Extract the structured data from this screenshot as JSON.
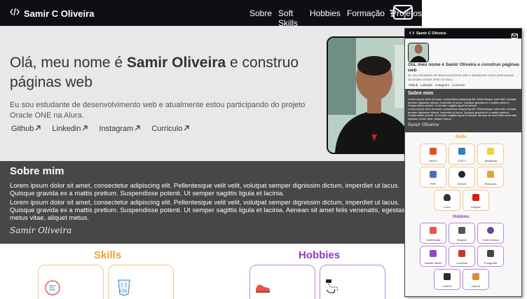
{
  "navbar": {
    "brand": "Samir C Oliveira",
    "links": [
      "Sobre",
      "Soft Skills",
      "Hobbies",
      "Formação",
      "Projetos"
    ]
  },
  "hero": {
    "title_plain": "Olá, meu nome é ",
    "title_bold": "Samir Oliveira",
    "title_end": " e construo páginas web",
    "description": "Eu sou estudante de desenvolvimento web e atualmente estou participando do projeto Oracle ONE na Alura.",
    "links": [
      "Github",
      "Linkedin",
      "Instagram",
      "Curriculo"
    ]
  },
  "about": {
    "heading": "Sobre mim",
    "p1": "Lorem ipsum dolor sit amet, consectetur adipiscing elit. Pellentesque velit velit, volutpat semper dignissim dictum, imperdiet ut lacus. Quisque gravida ex a mattis pretium. Suspendisse potenti. Ut semper sagittis ligula et lacinia.",
    "p2": "Lorem ipsum dolor sit amet, consectetur adipiscing elit. Pellentesque velit velit, volutpat semper dignissim dictum, imperdiet ut lacus. Quisque gravida ex a mattis pretium. Suspendisse potenti. Ut semper sagittis ligula et lacinia. Aenean sit amet felis venenatis, egestas metus vitae, aliquet metus.",
    "signature": "Samir Oliveira"
  },
  "sections": {
    "skills": "Skills",
    "hobbies": "Hobbies"
  },
  "mobile": {
    "brand": "Samir C Oliveira",
    "title": "Olá, meu nome é Samir Oliveira e construo páginas web",
    "description": "Eu sou estudante de desenvolvimento web e atualmente estou participando do projeto Oracle ONE na Alura.",
    "links": [
      "Github",
      "Linkedin",
      "Instagram",
      "Curriculo"
    ],
    "about_heading": "Sobre mim",
    "about_p1": "Lorem ipsum dolor sit amet, consectetur adipiscing elit. Pellentesque velit velit, volutpat semper dignissim dictum, imperdiet ut lacus. Quisque gravida ex a mattis pretium. Suspendisse potenti. Ut semper sagittis ligula et lacinia.",
    "about_p2": "Lorem ipsum dolor sit amet, consectetur adipiscing elit. Pellentesque velit velit, volutpat semper dignissim dictum, imperdiet ut lacus. Quisque gravida ex a mattis pretium. Suspendisse potenti. Ut semper sagittis ligula et lacinia. Aenean sit amet felis venenatis, egestas metus vitae, aliquet metus.",
    "signature": "Samir Oliveira",
    "skills_heading": "Skills",
    "skills": [
      "Html 5",
      "CSS 3",
      "Javascript",
      "PHP",
      "GitHub",
      "Fireworks",
      "Linux",
      "Angular"
    ],
    "hobbies_heading": "Hobbies",
    "hobbies": [
      "Caminhada",
      "Viagens",
      "Ouvir música",
      "Assistir filmes",
      "Cozinhar",
      "Fotografia",
      "Games",
      "Leitura"
    ]
  },
  "colors": {
    "navbar_bg": "#0e0f14",
    "about_bg": "#474747",
    "skills_accent": "#f0a033",
    "hobbies_accent": "#8e3cbf"
  },
  "icons": [
    "code-logo-icon",
    "mail-icon",
    "arrow-up-right-icon",
    "html-icon",
    "css-icon",
    "running-shoe-icon",
    "map-icon"
  ]
}
